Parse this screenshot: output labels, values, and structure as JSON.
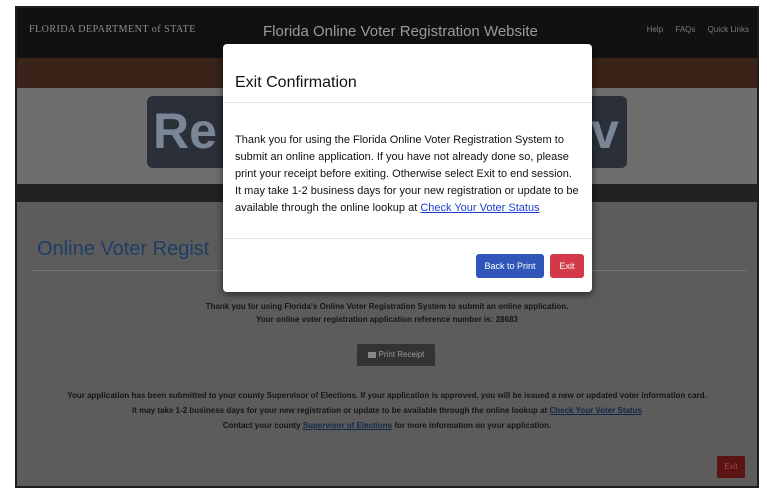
{
  "header": {
    "department": "FLORIDA DEPARTMENT of STATE",
    "site_title": "Florida Online Voter Registration Website",
    "links": [
      "Help",
      "FAQs",
      "Quick Links"
    ]
  },
  "banner": {
    "logo_left": "Re",
    "logo_right": "gov"
  },
  "page": {
    "title": "Online Voter Regist",
    "thanks_line1": "Thank you for using Florida's Online Voter Registration System to submit an online application.",
    "thanks_line2": "Your online voter registration application reference number is: 28683",
    "print_receipt_label": "Print Receipt",
    "submitted_line1": "Your application has been submitted to your county Supervisor of Elections. If your application is approved, you will be issued a new or updated voter information card.",
    "submitted_line2_prefix": "It may take 1-2 business days for your new registration or update to be available through the online lookup at ",
    "submitted_line2_link": "Check Your Voter Status",
    "submitted_line3_prefix": "Contact your county ",
    "submitted_line3_link": "Supervisor of Elections",
    "submitted_line3_suffix": " for more information on your application.",
    "exit_label": "Exit"
  },
  "modal": {
    "title": "Exit Confirmation",
    "body": "Thank you for using the Florida Online Voter Registration System to submit an online application. If you have not already done so, please print your receipt before exiting. Otherwise select Exit to end session. It may take 1-2 business days for your new registration or update to be available through the online lookup at ",
    "body_link": "Check Your Voter Status",
    "back_to_print_label": "Back to Print",
    "exit_label": "Exit"
  },
  "colors": {
    "modal_back_button": "#2f56b8",
    "modal_exit_button": "#d23a4a",
    "link": "#1a3fcc"
  }
}
